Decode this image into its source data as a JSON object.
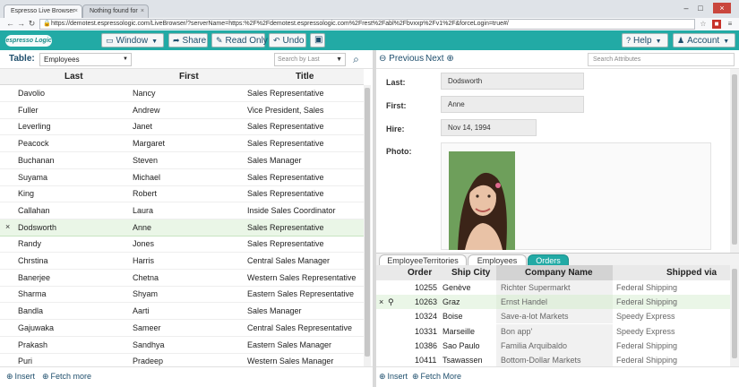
{
  "browser": {
    "tabs": [
      {
        "label": "Espresso Live Browser"
      },
      {
        "label": "Nothing found for Sdf"
      }
    ],
    "url": "https://demotest.espressologic.com/LiveBrowser/?serverName=https:%2F%2Fdemotest.espressologic.com%2Frest%2Fabl%2Fbvxxp%2Fv1%2F&forceLogin=true#/"
  },
  "toolbar": {
    "logo": "espresso Logic",
    "window_label": "Window",
    "share_label": "Share",
    "readonly_label": "Read Only",
    "undo_label": "Undo",
    "help_label": "Help",
    "account_label": "Account"
  },
  "left": {
    "table_label": "Table:",
    "table_value": "Employees",
    "search_placeholder": "Search by Last",
    "columns": [
      "Last",
      "First",
      "Title"
    ],
    "rows": [
      [
        "Davolio",
        "Nancy",
        "Sales Representative"
      ],
      [
        "Fuller",
        "Andrew",
        "Vice President, Sales"
      ],
      [
        "Leverling",
        "Janet",
        "Sales Representative"
      ],
      [
        "Peacock",
        "Margaret",
        "Sales Representative"
      ],
      [
        "Buchanan",
        "Steven",
        "Sales Manager"
      ],
      [
        "Suyama",
        "Michael",
        "Sales Representative"
      ],
      [
        "King",
        "Robert",
        "Sales Representative"
      ],
      [
        "Callahan",
        "Laura",
        "Inside Sales Coordinator"
      ],
      [
        "Dodsworth",
        "Anne",
        "Sales Representative"
      ],
      [
        "Randy",
        "Jones",
        "Sales Representative"
      ],
      [
        "Chrstina",
        "Harris",
        "Central Sales Manager"
      ],
      [
        "Banerjee",
        "Chetna",
        "Western Sales Representative"
      ],
      [
        "Sharma",
        "Shyam",
        "Eastern Sales Representative"
      ],
      [
        "Bandla",
        "Aarti",
        "Sales Manager"
      ],
      [
        "Gajuwaka",
        "Sameer",
        "Central Sales Representative"
      ],
      [
        "Prakash",
        "Sandhya",
        "Eastern Sales Manager"
      ],
      [
        "Puri",
        "Pradeep",
        "Western Sales Manager"
      ]
    ],
    "selected_mark": "×",
    "insert_label": "Insert",
    "fetch_label": "Fetch more"
  },
  "right": {
    "previous_label": "Previous",
    "next_label": "Next",
    "search_placeholder": "Search Attributes",
    "form": {
      "last_label": "Last:",
      "last_value": "Dodsworth",
      "first_label": "First:",
      "first_value": "Anne",
      "hire_label": "Hire:",
      "hire_value": "Nov 14, 1994",
      "photo_label": "Photo:"
    },
    "tabs": [
      "EmployeeTerritories",
      "Employees",
      "Orders"
    ],
    "columns": [
      "Order",
      "Ship City",
      "Company Name",
      "Shipped via"
    ],
    "orders": [
      [
        "10255",
        "Genève",
        "Richter Supermarkt",
        "Federal Shipping"
      ],
      [
        "10263",
        "Graz",
        "Ernst Handel",
        "Federal Shipping"
      ],
      [
        "10324",
        "Boise",
        "Save-a-lot Markets",
        "Speedy Express"
      ],
      [
        "10331",
        "Marseille",
        "Bon app'",
        "Speedy Express"
      ],
      [
        "10386",
        "Sao Paulo",
        "Familia Arquibaldo",
        "Federal Shipping"
      ],
      [
        "10411",
        "Tsawassen",
        "Bottom-Dollar Markets",
        "Federal Shipping"
      ]
    ],
    "selected_mark": "×",
    "insert_label": "Insert",
    "fetch_label": "Fetch More"
  }
}
